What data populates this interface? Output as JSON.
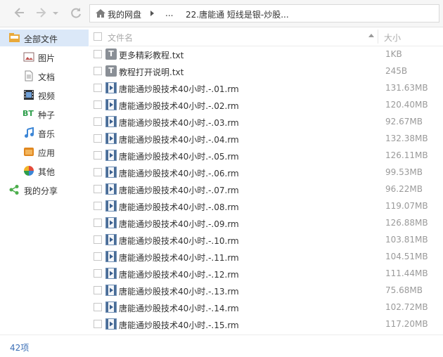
{
  "toolbar": {
    "breadcrumb": [
      "我的网盘",
      "...",
      "22.唐能通 短线是银-炒股..."
    ]
  },
  "sidebar": {
    "items": [
      {
        "label": "全部文件",
        "icon": "all-files-icon",
        "active": true
      },
      {
        "label": "图片",
        "icon": "picture-icon"
      },
      {
        "label": "文档",
        "icon": "document-icon"
      },
      {
        "label": "视频",
        "icon": "video-icon"
      },
      {
        "label": "种子",
        "icon": "bt-icon"
      },
      {
        "label": "音乐",
        "icon": "music-icon"
      },
      {
        "label": "应用",
        "icon": "app-icon"
      },
      {
        "label": "其他",
        "icon": "other-icon"
      },
      {
        "label": "我的分享",
        "icon": "share-icon"
      }
    ]
  },
  "header": {
    "name": "文件名",
    "size": "大小"
  },
  "files": [
    {
      "name": "更多精彩教程.txt",
      "size": "1KB",
      "type": "txt"
    },
    {
      "name": "教程打开说明.txt",
      "size": "245B",
      "type": "txt"
    },
    {
      "name": "唐能通炒股技术40小时.-.01.rm",
      "size": "131.63MB",
      "type": "video"
    },
    {
      "name": "唐能通炒股技术40小时.-.02.rm",
      "size": "120.40MB",
      "type": "video"
    },
    {
      "name": "唐能通炒股技术40小时.-.03.rm",
      "size": "92.67MB",
      "type": "video"
    },
    {
      "name": "唐能通炒股技术40小时.-.04.rm",
      "size": "132.38MB",
      "type": "video"
    },
    {
      "name": "唐能通炒股技术40小时.-.05.rm",
      "size": "126.11MB",
      "type": "video"
    },
    {
      "name": "唐能通炒股技术40小时.-.06.rm",
      "size": "99.53MB",
      "type": "video"
    },
    {
      "name": "唐能通炒股技术40小时.-.07.rm",
      "size": "96.22MB",
      "type": "video"
    },
    {
      "name": "唐能通炒股技术40小时.-.08.rm",
      "size": "119.07MB",
      "type": "video"
    },
    {
      "name": "唐能通炒股技术40小时.-.09.rm",
      "size": "126.88MB",
      "type": "video"
    },
    {
      "name": "唐能通炒股技术40小时.-.10.rm",
      "size": "103.81MB",
      "type": "video"
    },
    {
      "name": "唐能通炒股技术40小时.-.11.rm",
      "size": "104.51MB",
      "type": "video"
    },
    {
      "name": "唐能通炒股技术40小时.-.12.rm",
      "size": "111.44MB",
      "type": "video"
    },
    {
      "name": "唐能通炒股技术40小时.-.13.rm",
      "size": "75.68MB",
      "type": "video"
    },
    {
      "name": "唐能通炒股技术40小时.-.14.rm",
      "size": "102.72MB",
      "type": "video"
    },
    {
      "name": "唐能通炒股技术40小时.-.15.rm",
      "size": "117.20MB",
      "type": "video"
    }
  ],
  "status": {
    "count": "42项"
  }
}
